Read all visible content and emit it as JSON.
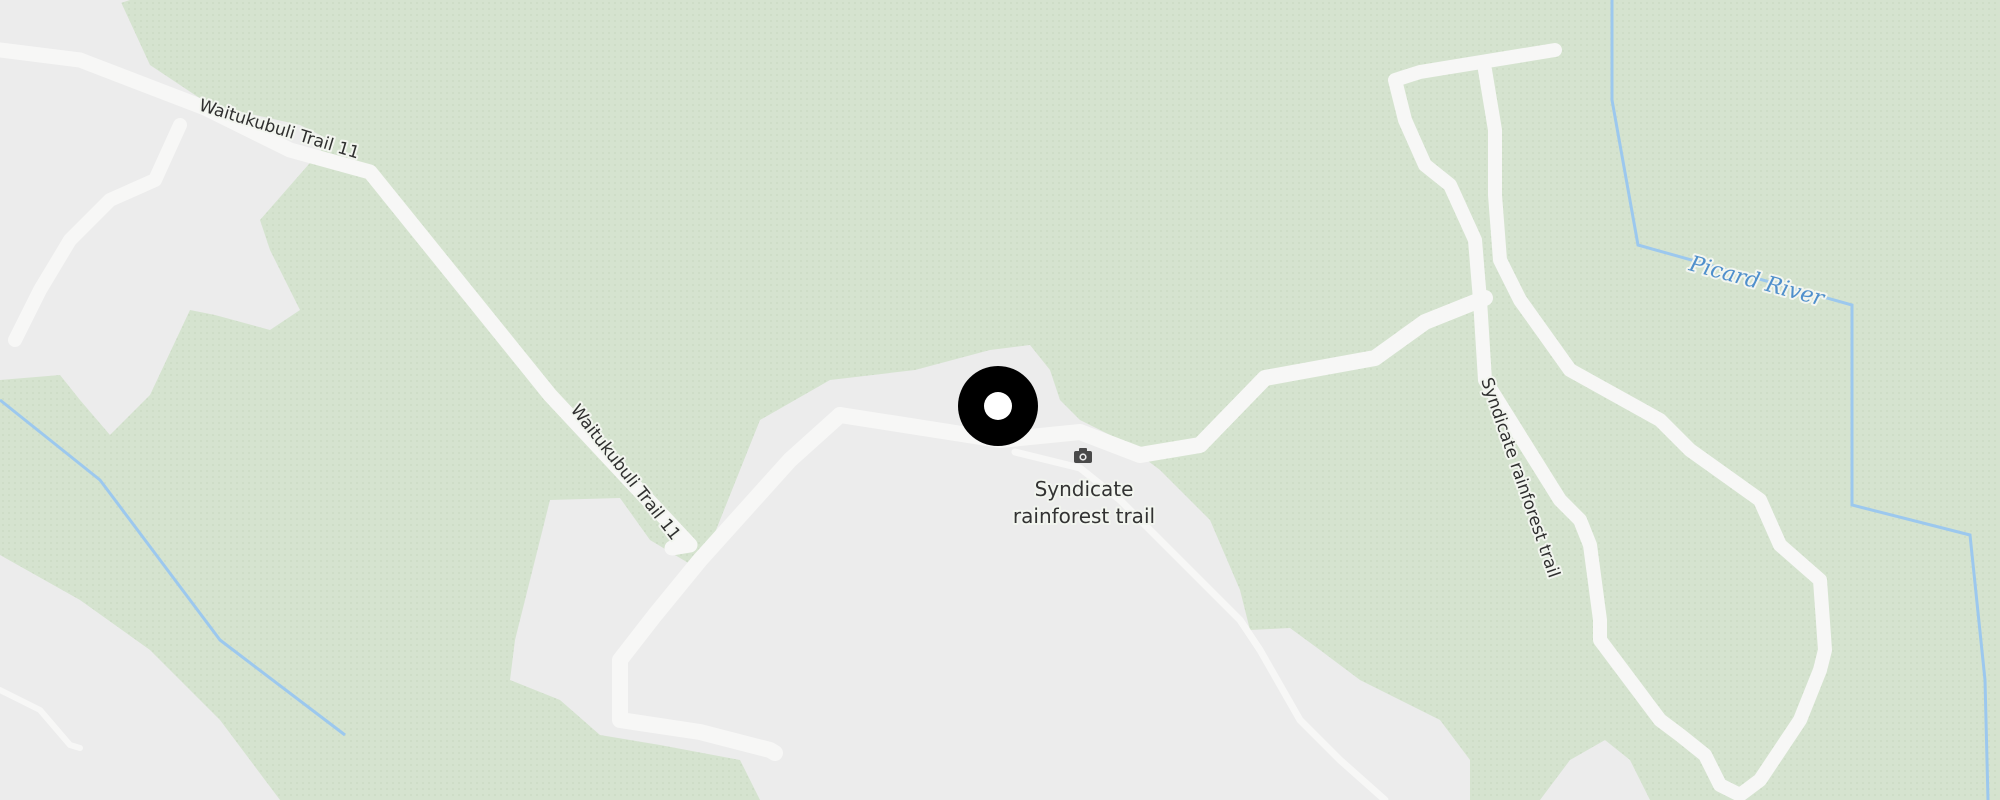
{
  "map": {
    "colors": {
      "vegetation": "#d5e3cf",
      "clearing": "#ececec",
      "path": "#f7f7f6",
      "water": "#9cc8ee",
      "river_label": "#4f8fcc",
      "pin": "#000000"
    },
    "labels": {
      "trail_upper": "Waitukubuli Trail 11",
      "trail_lower": "Waitukubuli Trail 11",
      "poi": "Syndicate rainforest trail",
      "poi_line1": "Syndicate",
      "poi_line2": "rainforest trail",
      "side_trail": "Syndicate rainforest trail",
      "river": "Picard River"
    },
    "icons": {
      "poi": "camera-icon",
      "marker": "location-pin-icon"
    }
  }
}
